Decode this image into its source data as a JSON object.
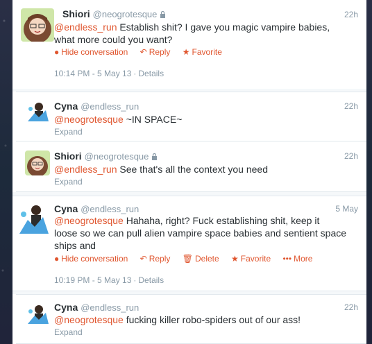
{
  "tweets": [
    {
      "name": "Shiori",
      "handle": "@neogrotesque",
      "time": "22h",
      "mention": "@endless_run",
      "text_line1": " Establish shit? I gave you magic vampire babies,",
      "text_line2": "what more could you want?",
      "actions": {
        "hide": "Hide conversation",
        "reply": "Reply",
        "favorite": "Favorite"
      },
      "timestamp": "10:14 PM - 5 May 13",
      "details": "Details"
    },
    {
      "name": "Cyna",
      "handle": "@endless_run",
      "time": "22h",
      "mention": "@neogrotesque",
      "text": " ~IN SPACE~",
      "expand": "Expand"
    },
    {
      "name": "Shiori",
      "handle": "@neogrotesque",
      "time": "22h",
      "mention": "@endless_run",
      "text": " See that's all the context you need",
      "expand": "Expand"
    },
    {
      "name": "Cyna",
      "handle": "@endless_run",
      "time": "5 May",
      "mention": "@neogrotesque",
      "text_line1": " Hahaha, right? Fuck establishing shit, keep it",
      "text_line2": "loose so we can pull alien vampire space babies and sentient space",
      "text_line3": "ships and",
      "actions": {
        "hide": "Hide conversation",
        "reply": "Reply",
        "delete": "Delete",
        "favorite": "Favorite",
        "more": "More"
      },
      "timestamp": "10:19 PM - 5 May 13",
      "details": "Details"
    },
    {
      "name": "Cyna",
      "handle": "@endless_run",
      "time": "22h",
      "mention": "@neogrotesque",
      "text": " fucking killer robo-spiders out of our ass!",
      "expand": "Expand"
    }
  ],
  "colors": {
    "accent": "#e0562f",
    "muted": "#8899a6",
    "text": "#292f33"
  },
  "icons": {
    "lock": "lock-icon",
    "comment": "comment-icon",
    "reply": "reply-arrow-icon",
    "favorite": "star-icon",
    "delete": "trash-icon",
    "more": "dots-icon"
  }
}
